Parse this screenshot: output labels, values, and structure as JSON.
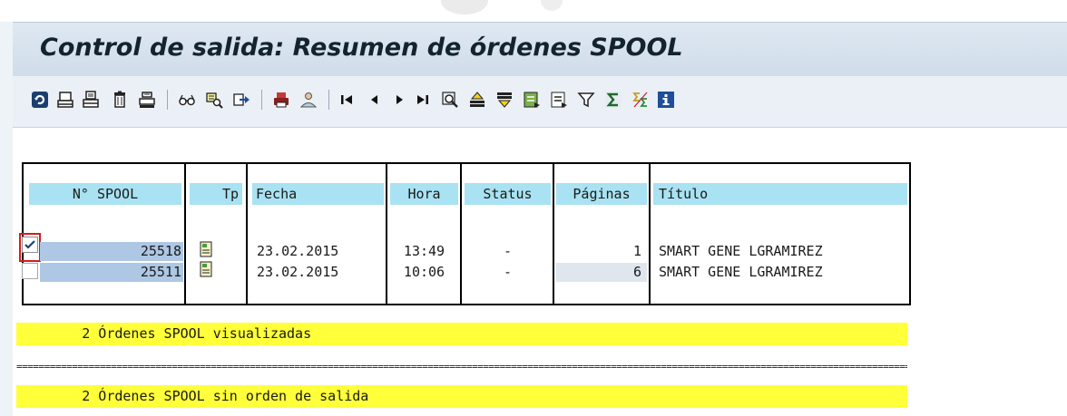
{
  "title": "Control de salida: Resumen de órdenes SPOOL",
  "toolbar": {
    "buttons": [
      {
        "icon": "refresh-icon"
      },
      {
        "icon": "print-icon"
      },
      {
        "icon": "print-preview-icon"
      },
      {
        "icon": "delete-trash-icon"
      },
      {
        "icon": "printer-settings-icon"
      },
      {
        "icon": "glasses-display-icon"
      },
      {
        "icon": "display-with-magnifier-icon"
      },
      {
        "icon": "forward-send-icon"
      },
      {
        "icon": "output-device-icon"
      },
      {
        "icon": "user-icon"
      },
      {
        "icon": "first-page-icon"
      },
      {
        "icon": "previous-page-icon"
      },
      {
        "icon": "next-page-icon"
      },
      {
        "icon": "last-page-icon"
      },
      {
        "icon": "find-icon"
      },
      {
        "icon": "sort-ascending-icon"
      },
      {
        "icon": "sort-descending-icon"
      },
      {
        "icon": "choose-layout-icon"
      },
      {
        "icon": "save-layout-icon"
      },
      {
        "icon": "filter-icon"
      },
      {
        "icon": "sum-icon"
      },
      {
        "icon": "subtotal-icon"
      },
      {
        "icon": "info-icon"
      }
    ]
  },
  "table": {
    "headers": {
      "spool": "N° SPOOL",
      "tp": "Tp",
      "fecha": "Fecha",
      "hora": "Hora",
      "status": "Status",
      "paginas": "Páginas",
      "titulo": "Título"
    },
    "rows": [
      {
        "checked": true,
        "spool": "25518",
        "fecha": "23.02.2015",
        "hora": "13:49",
        "status": "-",
        "paginas": "1",
        "titulo": "SMART GENE LGRAMIREZ"
      },
      {
        "checked": false,
        "spool": "25511",
        "fecha": "23.02.2015",
        "hora": "10:06",
        "status": "-",
        "paginas": "6",
        "titulo": "SMART GENE LGRAMIREZ"
      }
    ]
  },
  "summary": {
    "line1": "        2 Órdenes SPOOL visualizadas",
    "separator": "================================================================================================================================================================================================",
    "line2": "        2 Órdenes SPOOL sin orden de salida"
  },
  "colors": {
    "header_bg": "#a9e2f2",
    "selected_cell_bg": "#adc7e4",
    "summary_bg": "#ffff3a",
    "focus_border": "#d21c1c"
  }
}
